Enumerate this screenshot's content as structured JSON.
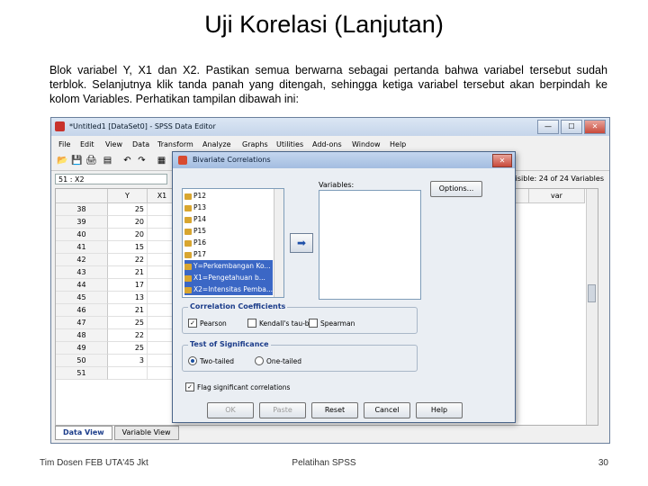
{
  "slide": {
    "title": "Uji Korelasi (Lanjutan)",
    "body": "Blok variabel Y, X1 dan X2. Pastikan semua berwarna sebagai pertanda bahwa variabel tersebut sudah terblok.  Selanjutnya klik tanda panah yang ditengah, sehingga ketiga variabel tersebut akan berpindah ke kolom Variables. Perhatikan tampilan dibawah ini:",
    "footer_left": "Tim Dosen FEB UTA'45 Jkt",
    "footer_center": "Pelatihan SPSS",
    "footer_right": "30"
  },
  "spss": {
    "window_title": "*Untitled1 [DataSet0] - SPSS Data Editor",
    "window_controls": {
      "minimize": "—",
      "maximize": "☐",
      "close": "✕"
    },
    "menu": [
      "File",
      "Edit",
      "View",
      "Data",
      "Transform",
      "Analyze",
      "Graphs",
      "Utilities",
      "Add-ons",
      "Window",
      "Help"
    ],
    "cell_ref": "51 : X2",
    "visible_count": "Visible: 24 of 24 Variables",
    "columns": [
      "Y",
      "X1"
    ],
    "extra_columns": [
      "var",
      "var"
    ],
    "rows": [
      {
        "num": "38",
        "y": "25"
      },
      {
        "num": "39",
        "y": "20"
      },
      {
        "num": "40",
        "y": "20"
      },
      {
        "num": "41",
        "y": "15"
      },
      {
        "num": "42",
        "y": "22"
      },
      {
        "num": "43",
        "y": "21"
      },
      {
        "num": "44",
        "y": "17"
      },
      {
        "num": "45",
        "y": "13"
      },
      {
        "num": "46",
        "y": "21"
      },
      {
        "num": "47",
        "y": "25"
      },
      {
        "num": "48",
        "y": "22"
      },
      {
        "num": "49",
        "y": "25"
      },
      {
        "num": "50",
        "y": "3"
      },
      {
        "num": "51",
        "y": ""
      }
    ],
    "tabs": [
      "Data View",
      "Variable View"
    ]
  },
  "dialog": {
    "title": "Bivariate Correlations",
    "close": "✕",
    "source_variables": [
      {
        "label": "P12",
        "selected": false
      },
      {
        "label": "P13",
        "selected": false
      },
      {
        "label": "P14",
        "selected": false
      },
      {
        "label": "P15",
        "selected": false
      },
      {
        "label": "P16",
        "selected": false
      },
      {
        "label": "P17",
        "selected": false
      },
      {
        "label": "Y=Perkembangan Ko...",
        "selected": true
      },
      {
        "label": "X1=Pengetahuan b...",
        "selected": true
      },
      {
        "label": "X2=Intensitas Pemba...",
        "selected": true
      }
    ],
    "move_arrow": "➡",
    "variables_label": "Variables:",
    "options_button": "Options...",
    "correlation_title": "Correlation Coefficients",
    "correlation_options": [
      {
        "label": "Pearson",
        "checked": true
      },
      {
        "label": "Kendall's tau-b",
        "checked": false
      },
      {
        "label": "Spearman",
        "checked": false
      }
    ],
    "significance_title": "Test of Significance",
    "significance_options": [
      {
        "label": "Two-tailed",
        "selected": true
      },
      {
        "label": "One-tailed",
        "selected": false
      }
    ],
    "flag_label": "Flag significant correlations",
    "flag_checked": true,
    "buttons": {
      "ok": "OK",
      "paste": "Paste",
      "reset": "Reset",
      "cancel": "Cancel",
      "help": "Help"
    }
  }
}
